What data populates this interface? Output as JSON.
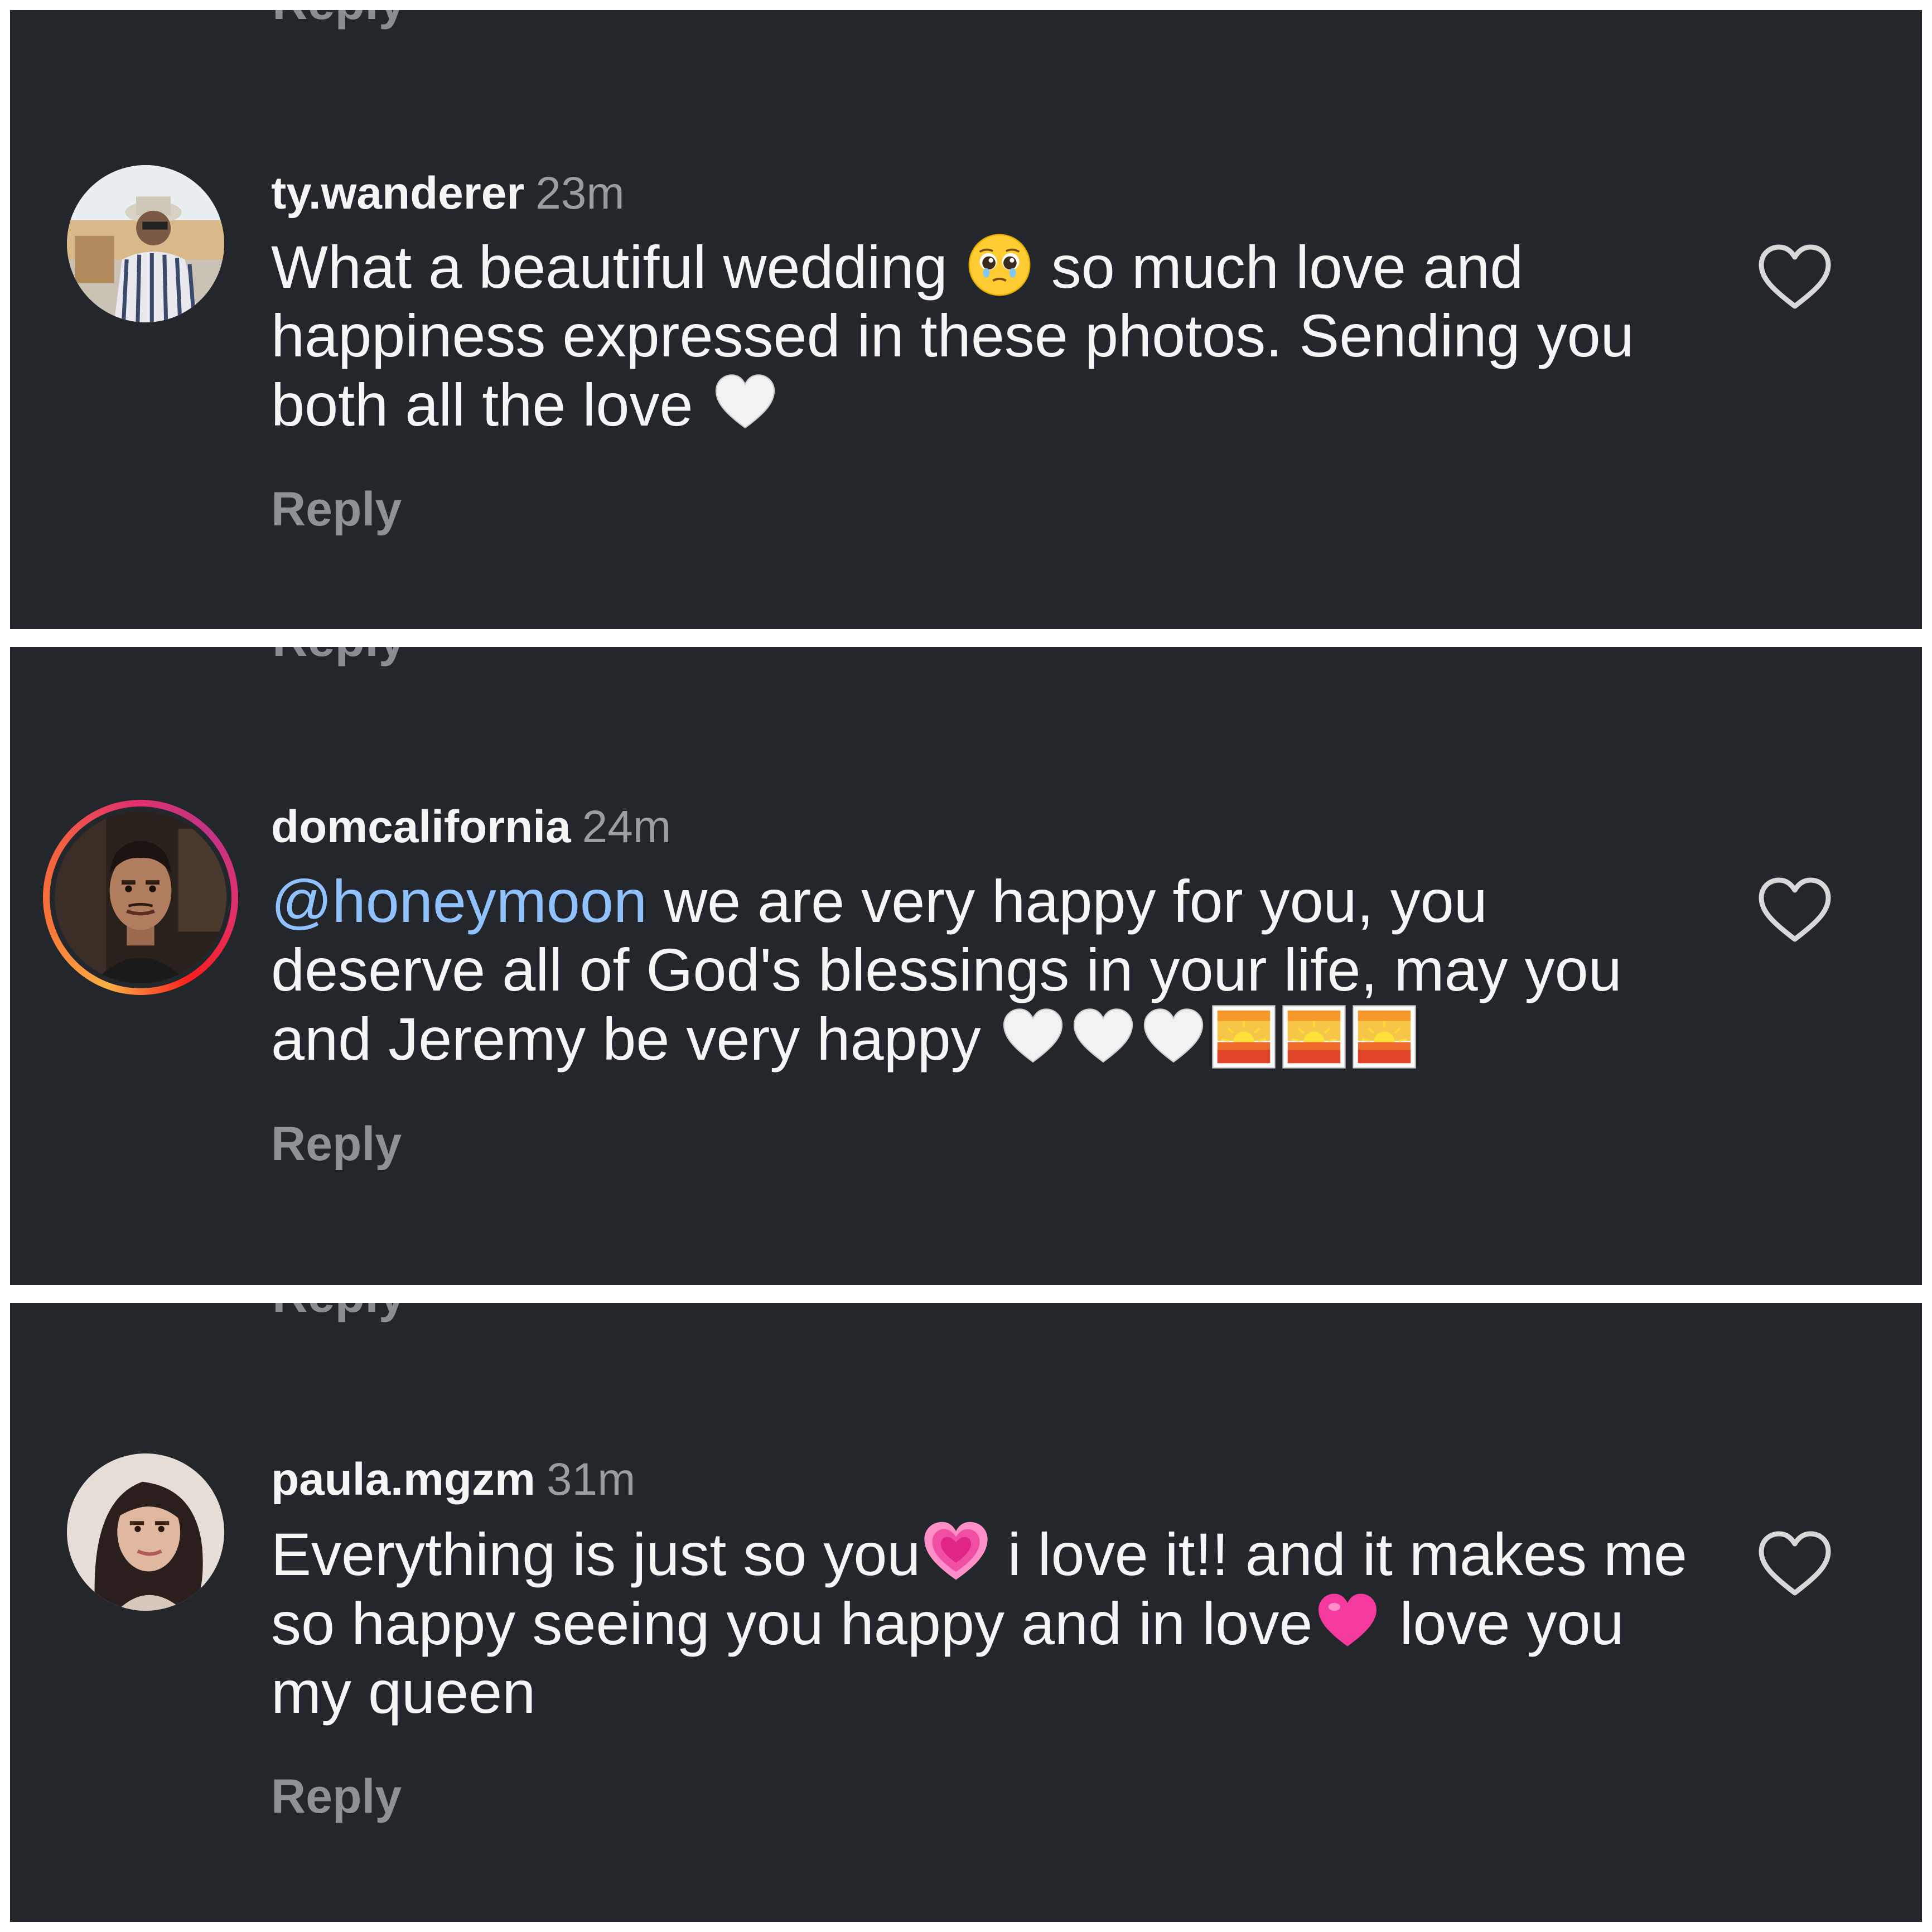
{
  "colors": {
    "background": "#23262b",
    "text": "#f5f5f5",
    "muted": "#9a9ea3",
    "mention": "#8fc2ff"
  },
  "comments": [
    {
      "username": "ty.wanderer",
      "time": "23m",
      "text_parts": [
        "What a beautiful wedding ",
        " so much love and happiness expressed in these photos. Sending you both all the love "
      ],
      "emojis": [
        "pleading-face-emoji",
        "white-heart-emoji"
      ],
      "reply_label": "Reply",
      "avatar_ring": false
    },
    {
      "username": "domcalifornia",
      "time": "24m",
      "mention": "@honeymoon",
      "text": " we are very happy for you, you deserve all of God's blessings in your life, may you and Jeremy be very happy ",
      "emojis": [
        "white-heart-emoji",
        "white-heart-emoji",
        "white-heart-emoji",
        "sunrise-emoji",
        "sunrise-emoji",
        "sunrise-emoji"
      ],
      "reply_label": "Reply",
      "avatar_ring": true
    },
    {
      "username": "paula.mgzm",
      "time": "31m",
      "text_parts": [
        "Everything is just so you",
        " i love it!! and it makes me so happy seeing you happy and in love",
        " love you my queen"
      ],
      "emojis": [
        "growing-heart-emoji",
        "pink-heart-emoji"
      ],
      "reply_label": "Reply",
      "avatar_ring": false
    }
  ],
  "cut_off_label": "Reply"
}
